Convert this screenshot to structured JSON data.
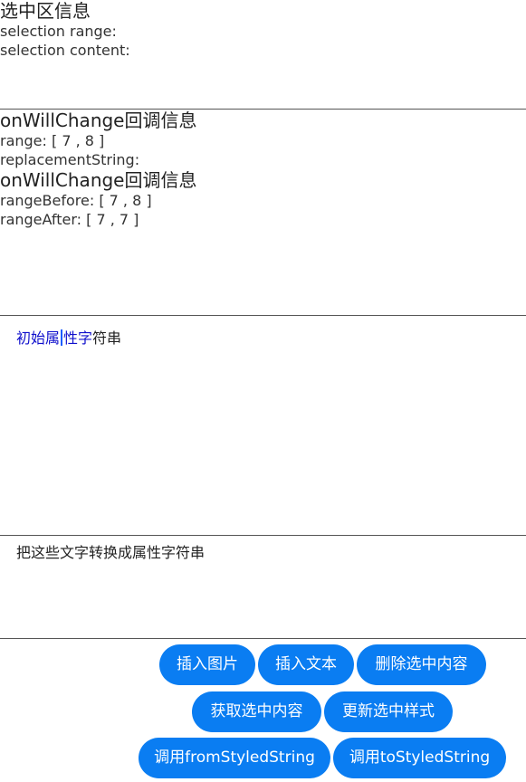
{
  "selection_info": {
    "title": "选中区信息",
    "range_label": "selection range:",
    "content_label": "selection content:"
  },
  "callback_info": {
    "will_change_title_1": "onWillChange回调信息",
    "range": "range: [ 7 , 8 ]",
    "replacement": "replacementString:",
    "will_change_title_2": "onWillChange回调信息",
    "range_before": "rangeBefore: [ 7 , 8 ]",
    "range_after": "rangeAfter: [ 7 , 7 ]"
  },
  "editor": {
    "styled_part_a": "初始属",
    "styled_part_b": "性字",
    "normal_part": "符串"
  },
  "plain_input": {
    "text": "把这些文字转换成属性字符串"
  },
  "buttons": {
    "insert_image": "插入图片",
    "insert_text": "插入文本",
    "delete_selection": "删除选中内容",
    "get_selection": "获取选中内容",
    "update_style": "更新选中样式",
    "from_styled": "调用fromStyledString",
    "to_styled": "调用toStyledString"
  },
  "colors": {
    "button_bg": "#0a7df2",
    "styled_text": "#1010cc",
    "caret": "#1a5cff"
  }
}
